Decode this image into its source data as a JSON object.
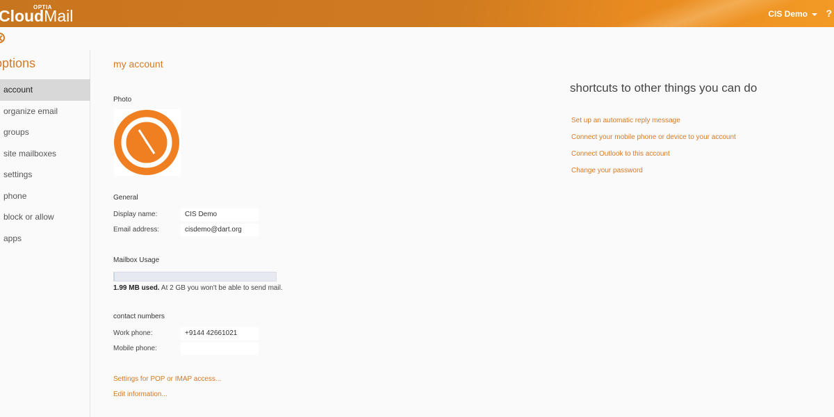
{
  "header": {
    "brand_small": "OPTIA",
    "brand_bold": "Cloud",
    "brand_light": "Mail",
    "user_name": "CIS Demo",
    "help_label": "?"
  },
  "sidebar": {
    "title": "options",
    "items": [
      {
        "label": "account",
        "active": true
      },
      {
        "label": "organize email"
      },
      {
        "label": "groups"
      },
      {
        "label": "site mailboxes"
      },
      {
        "label": "settings"
      },
      {
        "label": "phone"
      },
      {
        "label": "block or allow"
      },
      {
        "label": "apps"
      }
    ]
  },
  "account": {
    "title": "my account",
    "photo_label": "Photo",
    "general_label": "General",
    "display_name_label": "Display name:",
    "display_name": "CIS Demo",
    "email_label": "Email address:",
    "email": "cisdemo@dart.org",
    "mailbox_usage_label": "Mailbox Usage",
    "usage_amount": "1.99 MB used.",
    "usage_note": " At 2 GB you won't be able to send mail.",
    "usage_fraction": 0.001,
    "contact_label": "contact numbers",
    "work_phone_label": "Work phone:",
    "work_phone": "+9144 42661021",
    "mobile_phone_label": "Mobile phone:",
    "mobile_phone": "",
    "pop_imap_link": "Settings for POP or IMAP access...",
    "edit_link": "Edit information..."
  },
  "shortcuts": {
    "title": "shortcuts to other things you can do",
    "links": [
      "Set up an automatic reply message",
      "Connect your mobile phone or device to your account",
      "Connect Outlook to this account",
      "Change your password"
    ]
  },
  "colors": {
    "accent": "#d67a23",
    "header": "#cf7b20"
  }
}
